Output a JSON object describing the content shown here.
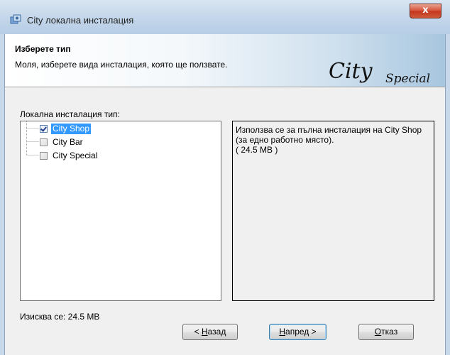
{
  "window": {
    "title": "City локална инсталация",
    "close_glyph": "x"
  },
  "header": {
    "title": "Изберете тип",
    "subtitle": "Моля, изберете вида инсталация, която ще ползвате.",
    "logo_text": "City Special"
  },
  "tree": {
    "label": "Локална инсталация тип:",
    "items": [
      {
        "label": "City Shop",
        "checked": true,
        "selected": true
      },
      {
        "label": "City Bar",
        "checked": false,
        "selected": false
      },
      {
        "label": "City Special",
        "checked": false,
        "selected": false
      }
    ]
  },
  "description": {
    "text": "Използва се за пълна инсталация на City Shop (за едно работно място).\n( 24.5 MB )"
  },
  "requirement": "Изисква се: 24.5 MB",
  "buttons": {
    "back_prefix": "< ",
    "back_hotkey": "Н",
    "back_rest": "азад",
    "next_hotkey": "Н",
    "next_rest": "апред >",
    "cancel_hotkey": "О",
    "cancel_rest": "тказ"
  },
  "colors": {
    "selection": "#3399ff",
    "title_bar": "#c3d6ea",
    "close_button": "#d7573e"
  }
}
